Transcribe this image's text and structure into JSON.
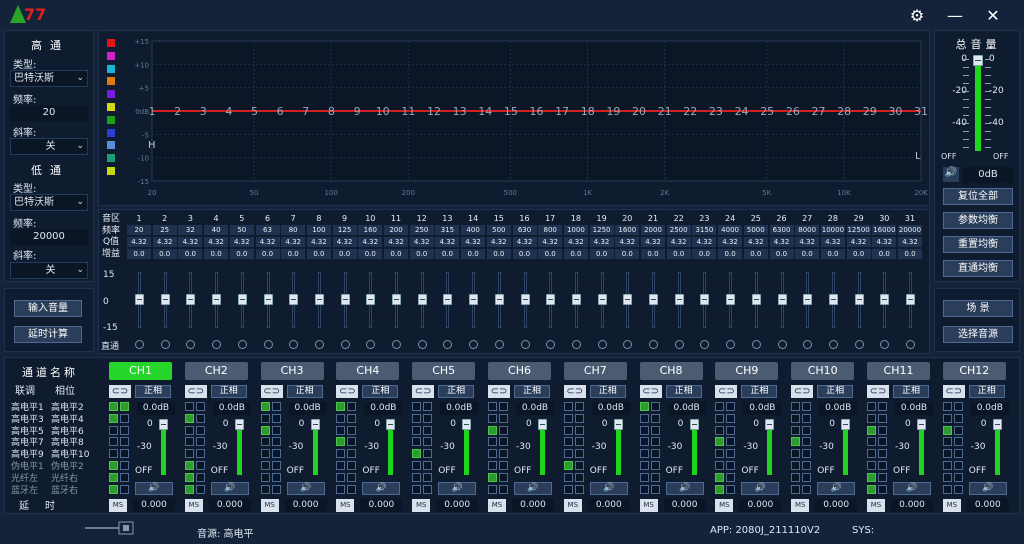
{
  "header": {
    "settings_icon": "gear-icon",
    "minimize_icon": "minus-icon",
    "close_icon": "close-icon"
  },
  "left": {
    "highpass_title": "高通",
    "type_label": "类型:",
    "hp_type": "巴特沃斯",
    "freq_label": "频率:",
    "hp_freq": "20",
    "slope_label": "斜率:",
    "hp_slope": "关",
    "lowpass_title": "低通",
    "lp_type": "巴特沃斯",
    "lp_freq": "20000",
    "lp_slope": "关",
    "input_level": "输入音量",
    "delay_calc": "延时计算"
  },
  "graph": {
    "y_ticks": [
      "+15",
      "+10",
      "+5",
      "0dB",
      "-5",
      "-10",
      "-15"
    ],
    "x_ticks": [
      "20",
      "50",
      "100",
      "200",
      "500",
      "1K",
      "2K",
      "5K",
      "10K",
      "20K"
    ],
    "band_labels": [
      "1",
      "2",
      "3",
      "4",
      "5",
      "6",
      "7",
      "8",
      "9",
      "10",
      "11",
      "12",
      "13",
      "14",
      "15",
      "16",
      "17",
      "18",
      "19",
      "20",
      "21",
      "22",
      "23",
      "24",
      "25",
      "26",
      "27",
      "28",
      "29",
      "30",
      "31"
    ],
    "hp_marker": "H",
    "lp_marker": "L",
    "swatches": [
      "#e0141b",
      "#d21fd2",
      "#1ab4d6",
      "#e07a14",
      "#7a1ae0",
      "#d6d614",
      "#1aa01a",
      "#2a3ed6",
      "#5a8ed6",
      "#1aa070",
      "#c8d614"
    ]
  },
  "bands": {
    "row_labels": [
      "音区",
      "频率",
      "Q值",
      "增益"
    ],
    "freq": [
      "20",
      "25",
      "32",
      "40",
      "50",
      "63",
      "80",
      "100",
      "125",
      "160",
      "200",
      "250",
      "315",
      "400",
      "500",
      "630",
      "800",
      "1000",
      "1250",
      "1600",
      "2000",
      "2500",
      "3150",
      "4000",
      "5000",
      "6300",
      "8000",
      "10000",
      "12500",
      "16000",
      "20000"
    ],
    "q": "4.32",
    "gain": "0.0",
    "fader_labels": [
      "15",
      "0",
      "-15"
    ],
    "bypass_label": "直通"
  },
  "right": {
    "master_title": "总音量",
    "meter_ticks": [
      "0",
      "-20",
      "-40"
    ],
    "off": "OFF",
    "master_value": "0dB",
    "buttons": [
      "复位全部",
      "参数均衡",
      "重置均衡",
      "直通均衡"
    ],
    "scene": "场 景",
    "source_select": "选择音源"
  },
  "channels_meta": {
    "title": "通道名称",
    "link": "联调",
    "phase": "相位",
    "names_left": [
      "高电平1",
      "高电平3",
      "高电平5",
      "高电平7",
      "高电平9",
      "伪电平1",
      "光纤左",
      "蓝牙左"
    ],
    "names_right": [
      "高电平2",
      "高电平4",
      "高电平6",
      "高电平8",
      "高电平10",
      "伪电平2",
      "光纤右",
      "蓝牙右"
    ],
    "delay": "延时"
  },
  "channels": [
    {
      "name": "CH1",
      "active": true
    },
    {
      "name": "CH2",
      "active": false
    },
    {
      "name": "CH3",
      "active": false
    },
    {
      "name": "CH4",
      "active": false
    },
    {
      "name": "CH5",
      "active": false
    },
    {
      "name": "CH6",
      "active": false
    },
    {
      "name": "CH7",
      "active": false
    },
    {
      "name": "CH8",
      "active": false
    },
    {
      "name": "CH9",
      "active": false
    },
    {
      "name": "CH10",
      "active": false
    },
    {
      "name": "CH11",
      "active": false
    },
    {
      "name": "CH12",
      "active": false
    }
  ],
  "channel_common": {
    "phase": "正相",
    "gain": "0.0dB",
    "scale": [
      "0",
      "-30",
      "OFF"
    ],
    "ms": "MS",
    "delay": "0.000"
  },
  "status": {
    "source_label": "音源: 高电平",
    "app": "APP: 2080J_211110V2",
    "sys": "SYS:"
  }
}
